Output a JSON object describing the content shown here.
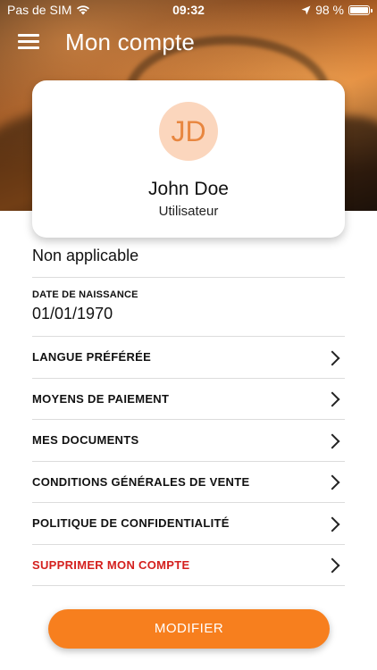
{
  "status_bar": {
    "carrier": "Pas de SIM",
    "time": "09:32",
    "battery": "98 %",
    "battery_level": 0.98
  },
  "nav": {
    "title": "Mon compte",
    "menu_icon": "hamburger-menu-icon"
  },
  "profile": {
    "initials": "JD",
    "name": "John Doe",
    "role": "Utilisateur"
  },
  "info": {
    "first_value": "Non applicable",
    "birth_label": "DATE DE NAISSANCE",
    "birth_value": "01/01/1970"
  },
  "menu_items": [
    {
      "label": "LANGUE PRÉFÉRÉE"
    },
    {
      "label": "MOYENS DE PAIEMENT"
    },
    {
      "label": "MES DOCUMENTS"
    },
    {
      "label": "CONDITIONS GÉNÉRALES DE VENTE"
    },
    {
      "label": "POLITIQUE DE CONFIDENTIALITÉ"
    },
    {
      "label": "SUPPRIMER MON COMPTE"
    }
  ],
  "actions": {
    "modify_label": "MODIFIER"
  },
  "colors": {
    "accent": "#f77f1e",
    "danger": "#d4201e",
    "avatar_bg": "#fbd6bd",
    "avatar_text": "#e8863f"
  }
}
